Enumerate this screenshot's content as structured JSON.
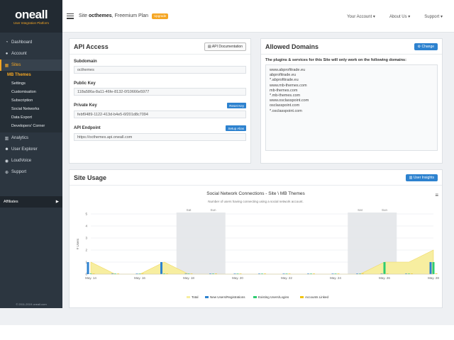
{
  "brand": {
    "name": "oneall",
    "tagline": "User Integration Platform"
  },
  "sidebar": {
    "items": [
      {
        "label": "Dashboard",
        "icon": "dashboard-icon"
      },
      {
        "label": "Account",
        "icon": "user-icon"
      },
      {
        "label": "Sites",
        "icon": "grid-icon",
        "active": true
      }
    ],
    "sub_title": "MB Themes",
    "sub_items": [
      "Settings",
      "Customisation",
      "Subscription",
      "Social Networks",
      "Data Export",
      "Developers' Corner"
    ],
    "items2": [
      {
        "label": "Analytics",
        "icon": "chart-icon"
      },
      {
        "label": "User Explorer",
        "icon": "users-icon"
      },
      {
        "label": "LoudVoice",
        "icon": "comment-icon"
      },
      {
        "label": "Support",
        "icon": "support-icon"
      }
    ],
    "affiliates": "Affiliates",
    "copyright": "© 2011-2019 oneall.com"
  },
  "topbar": {
    "site_prefix": "Site",
    "site_name": "octhemes",
    "plan": ", Freemium Plan",
    "upgrade": "Upgrade",
    "nav": [
      "Your Account ▾",
      "About Us ▾",
      "Support ▾"
    ]
  },
  "api": {
    "title": "API Access",
    "doc_button": "API Documentation",
    "subdomain_label": "Subdomain",
    "subdomain": "octhemes",
    "public_key_label": "Public Key",
    "public_key": "118a586a-8a11-46fe-8132-0f10666e5977",
    "private_key_label": "Private Key",
    "private_key": "febf9489-1122-413d-b4e5-6f201d8c7094",
    "reset_button": "Reset Key",
    "endpoint_label": "API Endpoint",
    "endpoint": "https://octhemes.api.oneall.com",
    "setup_button": "Setup Alias"
  },
  "domains": {
    "title": "Allowed Domains",
    "change_button": "Change",
    "intro": "The plugins & services for this Site will only work on the following domains:",
    "list": [
      "www.abprofitrade.eu",
      "abprofitrade.eu",
      "*.abprofitrade.eu",
      "www.mb-themes.com",
      "mb-themes.com",
      "*.mb-themes.com",
      "www.osclasspoint.com",
      "osclasspoint.com",
      "*.osclasspoint.com"
    ]
  },
  "usage": {
    "title": "Site Usage",
    "insights_button": "User Insights"
  },
  "chart_data": {
    "type": "area",
    "title": "Social Network Connections - Site \\ MB Themes",
    "subtitle": "Number of users having connecting using a social network account.",
    "ylabel": "# Users",
    "ylim": [
      0,
      5
    ],
    "yticks": [
      0,
      1,
      2,
      3,
      4,
      5
    ],
    "x": [
      "May. 14",
      "May. 15",
      "May. 16",
      "May. 17",
      "May. 18",
      "May. 19",
      "May. 20",
      "May. 21",
      "May. 22",
      "May. 23",
      "May. 24",
      "May. 25",
      "May. 26",
      "May. 27",
      "May. 28"
    ],
    "x_tick_labels": [
      "May. 14",
      "May. 16",
      "May. 18",
      "May. 20",
      "May. 22",
      "May. 24",
      "May. 26",
      "May. 28"
    ],
    "weekend_bands": [
      {
        "from": "May. 18",
        "to": "May. 19",
        "labels": [
          "Sat",
          "Sun"
        ]
      },
      {
        "from": "May. 25",
        "to": "May. 26",
        "labels": [
          "Sat",
          "Sun"
        ]
      }
    ],
    "series": [
      {
        "name": "Total",
        "type": "area",
        "color": "#f7eea0",
        "values": [
          1,
          0,
          0,
          1,
          0,
          0,
          0,
          0,
          0,
          0,
          0,
          0,
          1,
          1,
          2
        ]
      },
      {
        "name": "New Users/Registrations",
        "type": "bar",
        "color": "#2d82cf",
        "values": [
          1,
          0,
          0,
          1,
          0,
          0,
          0,
          0,
          0,
          0,
          0,
          0,
          0,
          0,
          1
        ]
      },
      {
        "name": "Existing Users/Logins",
        "type": "bar",
        "color": "#2ecc71",
        "values": [
          0,
          0,
          0,
          0,
          0,
          0,
          0,
          0,
          0,
          0,
          0,
          0,
          1,
          0,
          1
        ]
      },
      {
        "name": "Accounts Linked",
        "type": "bar",
        "color": "#f1c40f",
        "values": [
          0,
          0,
          0,
          0,
          0,
          0,
          0,
          0,
          0,
          0,
          0,
          0,
          0,
          0,
          0
        ]
      }
    ],
    "legend": "bottom"
  }
}
